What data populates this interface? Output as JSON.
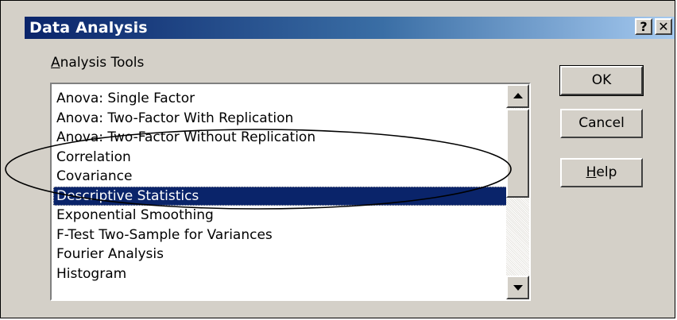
{
  "window": {
    "title": "Data Analysis",
    "help_glyph": "?",
    "close_glyph": "✕"
  },
  "tools_label": {
    "first": "A",
    "rest": "nalysis Tools"
  },
  "analysis_tools": [
    "Anova: Single Factor",
    "Anova: Two-Factor With Replication",
    "Anova: Two-Factor Without Replication",
    "Correlation",
    "Covariance",
    "Descriptive Statistics",
    "Exponential Smoothing",
    "F-Test Two-Sample for Variances",
    "Fourier Analysis",
    "Histogram"
  ],
  "selected_tool": "Descriptive Statistics",
  "buttons": {
    "ok": "OK",
    "cancel": "Cancel",
    "help_first": "H",
    "help_rest": "elp"
  },
  "colors": {
    "selection": "#0a246a",
    "face": "#d4d0c8"
  }
}
